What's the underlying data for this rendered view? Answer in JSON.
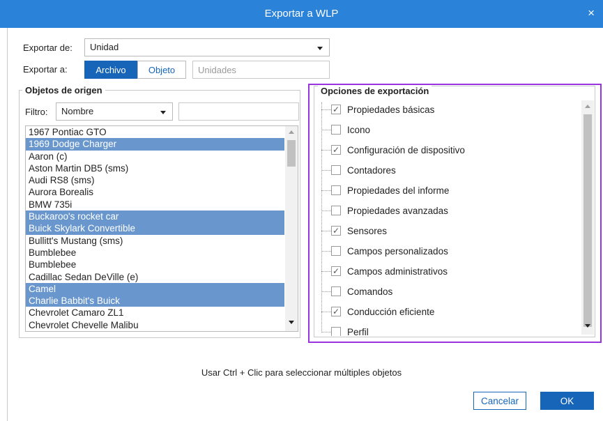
{
  "window": {
    "title": "Exportar a WLP",
    "close": "×"
  },
  "export_from": {
    "label": "Exportar de:",
    "value": "Unidad"
  },
  "export_to": {
    "label": "Exportar a:",
    "archivo": "Archivo",
    "objeto": "Objeto",
    "units_placeholder": "Unidades"
  },
  "source": {
    "legend": "Objetos de origen",
    "filter_label": "Filtro:",
    "filter_value": "Nombre",
    "items": [
      {
        "name": "1967 Pontiac GTO",
        "selected": false
      },
      {
        "name": "1969 Dodge Charger",
        "selected": true
      },
      {
        "name": "Aaron (c)",
        "selected": false
      },
      {
        "name": "Aston Martin DB5 (sms)",
        "selected": false
      },
      {
        "name": "Audi RS8 (sms)",
        "selected": false
      },
      {
        "name": "Aurora Borealis",
        "selected": false
      },
      {
        "name": "BMW 735i",
        "selected": false
      },
      {
        "name": "Buckaroo's rocket car",
        "selected": true
      },
      {
        "name": "Buick Skylark Convertible",
        "selected": true
      },
      {
        "name": "Bullitt's Mustang (sms)",
        "selected": false
      },
      {
        "name": "Bumblebee",
        "selected": false
      },
      {
        "name": "Bumblebee",
        "selected": false
      },
      {
        "name": "Cadillac Sedan DeVille (e)",
        "selected": false
      },
      {
        "name": "Camel",
        "selected": true
      },
      {
        "name": "Charlie Babbit's Buick",
        "selected": true
      },
      {
        "name": "Chevrolet Camaro ZL1",
        "selected": false
      },
      {
        "name": "Chevrolet Chevelle Malibu",
        "selected": false
      }
    ]
  },
  "options": {
    "legend": "Opciones de exportación",
    "items": [
      {
        "label": "Propiedades básicas",
        "checked": true
      },
      {
        "label": "Icono",
        "checked": false
      },
      {
        "label": "Configuración de dispositivo",
        "checked": true
      },
      {
        "label": "Contadores",
        "checked": false
      },
      {
        "label": "Propiedades del informe",
        "checked": false
      },
      {
        "label": "Propiedades avanzadas",
        "checked": false
      },
      {
        "label": "Sensores",
        "checked": true
      },
      {
        "label": "Campos personalizados",
        "checked": false
      },
      {
        "label": "Campos administrativos",
        "checked": true
      },
      {
        "label": "Comandos",
        "checked": false
      },
      {
        "label": "Conducción eficiente",
        "checked": true
      },
      {
        "label": "Perfil",
        "checked": false
      }
    ]
  },
  "hint": "Usar Ctrl + Clic para seleccionar múltiples objetos",
  "buttons": {
    "cancel": "Cancelar",
    "ok": "OK"
  },
  "colors": {
    "titlebar": "#2b82d9",
    "primary": "#1665b8",
    "selection": "#6997cd",
    "highlight": "#9933dd"
  }
}
